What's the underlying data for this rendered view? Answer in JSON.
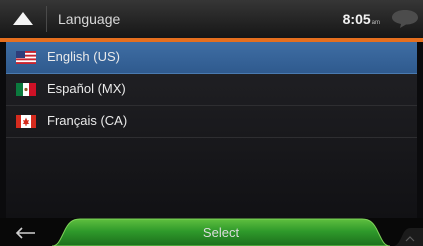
{
  "header": {
    "title": "Language",
    "time": "8:05",
    "ampm": "am",
    "up_icon": "chevron-up-icon",
    "message_icon": "message-bubble-icon",
    "accent_color": "#e56f1f"
  },
  "languages": [
    {
      "label": "English (US)",
      "flag": "us-flag-icon",
      "selected": true
    },
    {
      "label": "Español (MX)",
      "flag": "mexico-flag-icon",
      "selected": false
    },
    {
      "label": "Français (CA)",
      "flag": "canada-flag-icon",
      "selected": false
    }
  ],
  "footer": {
    "back_icon": "back-arrow-icon",
    "select_label": "Select",
    "scroll_icon": "scroll-up-icon",
    "select_color": "#2e8f2a"
  },
  "colors": {
    "selected_row": "#3a67a0"
  }
}
